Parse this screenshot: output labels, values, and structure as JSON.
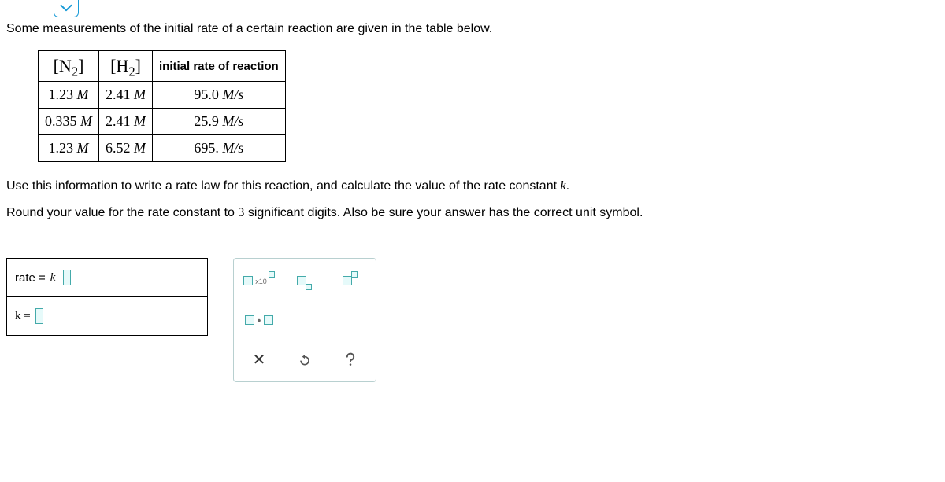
{
  "chevron": "chevron-down",
  "intro": "Some measurements of the initial rate of a certain reaction are given in the table below.",
  "table": {
    "headers": {
      "n2_open": "[N",
      "n2_sub": "2",
      "n2_close": "]",
      "h2_open": "[H",
      "h2_sub": "2",
      "h2_close": "]",
      "rate": "initial rate of reaction"
    },
    "rows": [
      {
        "n2": "1.23",
        "n2unit": "M",
        "h2": "2.41",
        "h2unit": "M",
        "rate": "95.0",
        "rateunit": "M/s"
      },
      {
        "n2": "0.335",
        "n2unit": "M",
        "h2": "2.41",
        "h2unit": "M",
        "rate": "25.9",
        "rateunit": "M/s"
      },
      {
        "n2": "1.23",
        "n2unit": "M",
        "h2": "6.52",
        "h2unit": "M",
        "rate": "695.",
        "rateunit": "M/s"
      }
    ]
  },
  "instr_a": "Use this information to write a rate law for this reaction, and calculate the value of the rate constant ",
  "instr_k": "k",
  "instr_period": ".",
  "instr_b_pre": "Round your value for the rate constant to ",
  "instr_b_num": "3",
  "instr_b_post": " significant digits. Also be sure your answer has the correct unit symbol.",
  "answers": {
    "rate_label": "rate = ",
    "rate_k": "k",
    "k_label": "k = "
  },
  "palette": {
    "x10": "x10"
  }
}
